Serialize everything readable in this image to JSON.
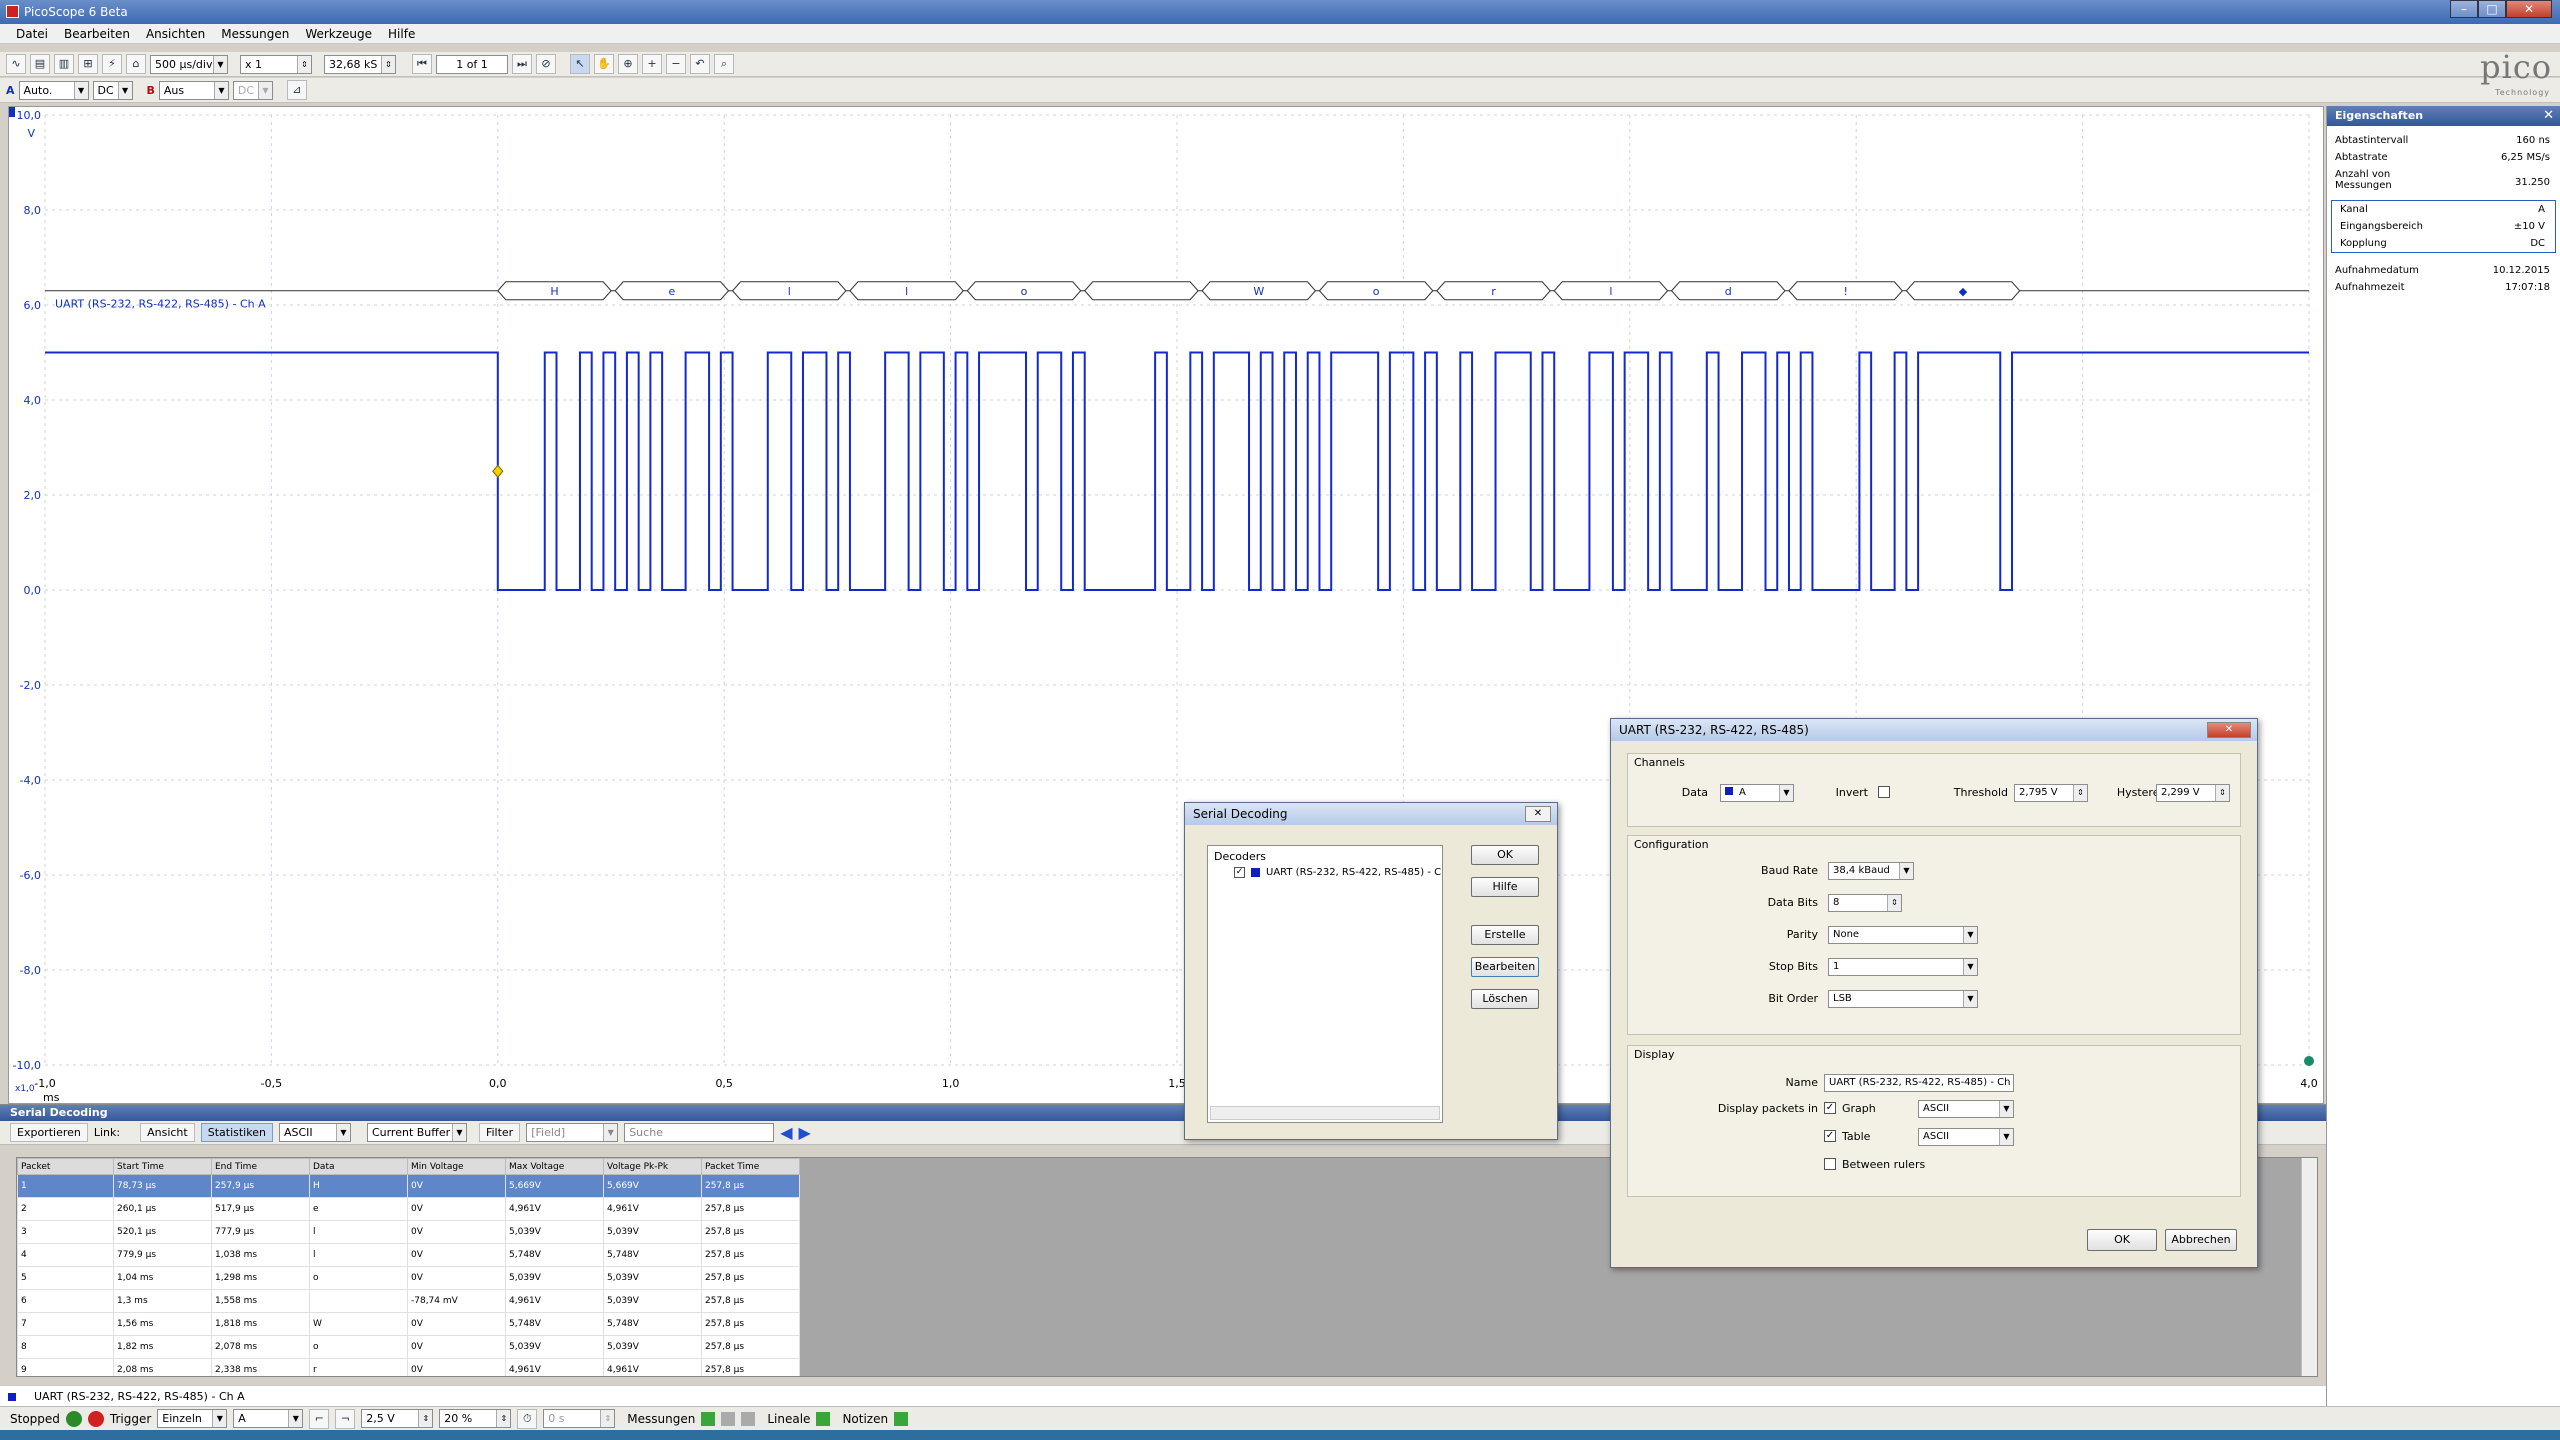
{
  "window": {
    "title": "PicoScope 6 Beta",
    "minimize": "–",
    "maximize": "□",
    "close": "✕"
  },
  "menu": [
    "Datei",
    "Bearbeiten",
    "Ansichten",
    "Messungen",
    "Werkzeuge",
    "Hilfe"
  ],
  "toolbar": {
    "timebase": "500 µs/div",
    "zoom": "x 1",
    "samples": "32,68 kS",
    "buffer": "1 of 1"
  },
  "channel_bar": {
    "a_label": "A",
    "a_range": "Auto.",
    "a_coupling": "DC",
    "b_label": "B",
    "b_range": "Aus",
    "b_coupling": "DC"
  },
  "logo": {
    "text": "pico",
    "sub": "Technology"
  },
  "scope": {
    "y_unit": "V",
    "y_ticks": [
      "10,0",
      "8,0",
      "6,0",
      "4,0",
      "2,0",
      "0,0",
      "-2,0",
      "-4,0",
      "-6,0",
      "-8,0",
      "-10,0"
    ],
    "x_ticks": [
      "-1,0",
      "-0,5",
      "0,0",
      "0,5",
      "1,0",
      "1,5",
      "4,0"
    ],
    "x_unit": "ms",
    "x_mult": "x1,0",
    "decode_label": "UART (RS-232, RS-422, RS-485) - Ch A",
    "decoded_chars": [
      "H",
      "e",
      "l",
      "l",
      "o",
      "",
      "W",
      "o",
      "r",
      "l",
      "d",
      "!",
      "◆"
    ]
  },
  "chart_data": {
    "type": "line",
    "xlabel": "ms",
    "ylabel": "V",
    "xlim": [
      -1.0,
      4.0
    ],
    "ylim": [
      -10.0,
      10.0
    ],
    "series": [
      {
        "name": "Ch A",
        "levels": {
          "idle_high": 5.0,
          "low": 0.0
        },
        "frame_start_ms": 0.0,
        "frame_end_ms": 3.37
      }
    ]
  },
  "properties": {
    "header": "Eigenschaften",
    "rows": [
      {
        "label": "Abtastintervall",
        "value": "160 ns"
      },
      {
        "label": "Abtastrate",
        "value": "6,25 MS/s"
      },
      {
        "label": "Anzahl von Messungen",
        "value": "31.250"
      }
    ],
    "box": [
      {
        "label": "Kanal",
        "value": "A"
      },
      {
        "label": "Eingangsbereich",
        "value": "±10 V"
      },
      {
        "label": "Kopplung",
        "value": "DC"
      }
    ],
    "rows2": [
      {
        "label": "Aufnahmedatum",
        "value": "10.12.2015"
      },
      {
        "label": "Aufnahmezeit",
        "value": "17:07:18"
      }
    ]
  },
  "serial_decoding_panel": {
    "header": "Serial Decoding",
    "tools": {
      "export": "Exportieren",
      "link": "Link:",
      "view": "Ansicht",
      "stats": "Statistiken",
      "format": "ASCII",
      "buffer": "Current Buffer",
      "filter": "Filter",
      "field": "[Field]",
      "search": "Suche"
    },
    "columns": [
      "Packet",
      "Start Time",
      "End Time",
      "Data",
      "Min Voltage",
      "Max Voltage",
      "Voltage Pk-Pk",
      "Packet Time"
    ],
    "rows": [
      [
        "1",
        "78,73 µs",
        "257,9 µs",
        "H",
        "0V",
        "5,669V",
        "5,669V",
        "257,8 µs"
      ],
      [
        "2",
        "260,1 µs",
        "517,9 µs",
        "e",
        "0V",
        "4,961V",
        "4,961V",
        "257,8 µs"
      ],
      [
        "3",
        "520,1 µs",
        "777,9 µs",
        "l",
        "0V",
        "5,039V",
        "5,039V",
        "257,8 µs"
      ],
      [
        "4",
        "779,9 µs",
        "1,038 ms",
        "l",
        "0V",
        "5,748V",
        "5,748V",
        "257,8 µs"
      ],
      [
        "5",
        "1,04 ms",
        "1,298 ms",
        "o",
        "0V",
        "5,039V",
        "5,039V",
        "257,8 µs"
      ],
      [
        "6",
        "1,3 ms",
        "1,558 ms",
        "",
        "-78,74 mV",
        "4,961V",
        "5,039V",
        "257,8 µs"
      ],
      [
        "7",
        "1,56 ms",
        "1,818 ms",
        "W",
        "0V",
        "5,748V",
        "5,748V",
        "257,8 µs"
      ],
      [
        "8",
        "1,82 ms",
        "2,078 ms",
        "o",
        "0V",
        "5,039V",
        "5,039V",
        "257,8 µs"
      ],
      [
        "9",
        "2,08 ms",
        "2,338 ms",
        "r",
        "0V",
        "4,961V",
        "4,961V",
        "257,8 µs"
      ]
    ],
    "footer": "UART (RS-232, RS-422, RS-485) - Ch A"
  },
  "status": {
    "state": "Stopped",
    "trigger_label": "Trigger",
    "trigger_mode": "Einzeln",
    "trigger_channel": "A",
    "level": "2,5 V",
    "pretrigger": "20 %",
    "delay": "0 s",
    "measurements": "Messungen",
    "rulers": "Lineale",
    "notes": "Notizen"
  },
  "serial_dialog": {
    "title": "Serial Decoding",
    "decoders_label": "Decoders",
    "decoder_item": "UART (RS-232, RS-422, RS-485) - C",
    "buttons": [
      "OK",
      "Hilfe",
      "Erstelle",
      "Bearbeiten",
      "Löschen"
    ],
    "close": "✕"
  },
  "uart_dialog": {
    "title": "UART (RS-232, RS-422, RS-485)",
    "close": "✕",
    "channels_label": "Channels",
    "data_label": "Data",
    "data_value": "A",
    "invert_label": "Invert",
    "threshold_label": "Threshold",
    "threshold_value": "2,795 V",
    "hysteresis_label": "Hysteresis",
    "hysteresis_value": "2,299 V",
    "config_label": "Configuration",
    "baud_label": "Baud Rate",
    "baud_value": "38,4 kBaud",
    "bits_label": "Data Bits",
    "bits_value": "8",
    "parity_label": "Parity",
    "parity_value": "None",
    "stop_label": "Stop Bits",
    "stop_value": "1",
    "order_label": "Bit Order",
    "order_value": "LSB",
    "display_label": "Display",
    "name_label": "Name",
    "name_value": "UART (RS-232, RS-422, RS-485) - Ch A",
    "packets_label": "Display packets in",
    "graph_label": "Graph",
    "graph_format": "ASCII",
    "table_label": "Table",
    "table_format": "ASCII",
    "rulers_label": "Between rulers",
    "ok": "OK",
    "cancel": "Abbrechen"
  }
}
